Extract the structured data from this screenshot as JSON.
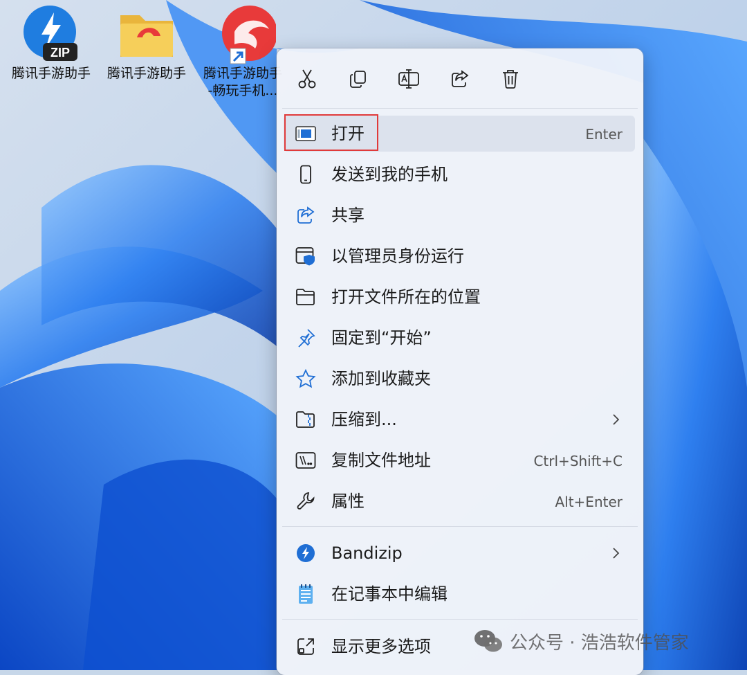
{
  "desktop": {
    "icons": [
      {
        "label": "腾讯手游助手",
        "icon": "zip-archive-icon",
        "badge": "ZIP",
        "color": "#1f7de0"
      },
      {
        "label": "腾讯手游助手",
        "icon": "folder-icon",
        "color": "#f2c24a"
      },
      {
        "label_line1": "腾讯手游助手",
        "label_line2": "-畅玩手机...",
        "icon": "tencent-assistant-icon",
        "color": "#e83a3a"
      }
    ]
  },
  "context_menu": {
    "toolbar": [
      {
        "name": "cut",
        "icon": "scissors-icon"
      },
      {
        "name": "copy",
        "icon": "copy-icon"
      },
      {
        "name": "rename",
        "icon": "rename-icon"
      },
      {
        "name": "share",
        "icon": "share-icon"
      },
      {
        "name": "delete",
        "icon": "trash-icon"
      }
    ],
    "items": [
      {
        "label": "打开",
        "shortcut": "Enter",
        "icon": "open-window-icon",
        "highlighted": true
      },
      {
        "label": "发送到我的手机",
        "icon": "phone-icon"
      },
      {
        "label": "共享",
        "icon": "share-icon"
      },
      {
        "label": "以管理员身份运行",
        "icon": "admin-shield-icon"
      },
      {
        "label": "打开文件所在的位置",
        "icon": "folder-open-icon"
      },
      {
        "label": "固定到“开始”",
        "icon": "pin-icon"
      },
      {
        "label": "添加到收藏夹",
        "icon": "star-icon"
      },
      {
        "label": "压缩到...",
        "icon": "zip-folder-icon",
        "submenu": true
      },
      {
        "label": "复制文件地址",
        "shortcut": "Ctrl+Shift+C",
        "icon": "copy-path-icon"
      },
      {
        "label": "属性",
        "shortcut": "Alt+Enter",
        "icon": "wrench-icon"
      },
      {
        "label": "Bandizip",
        "icon": "bandizip-icon",
        "submenu": true
      },
      {
        "label": "在记事本中编辑",
        "icon": "notepad-icon"
      },
      {
        "label": "显示更多选项",
        "icon": "more-options-icon"
      }
    ]
  },
  "watermark": {
    "text": "公众号 · 浩浩软件管家"
  },
  "colors": {
    "accent": "#0067c0",
    "highlight_box": "#e03a3a"
  }
}
